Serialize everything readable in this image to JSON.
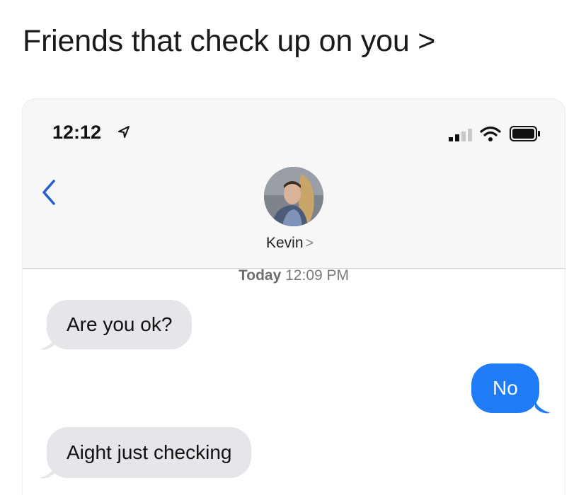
{
  "caption": "Friends that check up on you >",
  "status_bar": {
    "time": "12:12",
    "icons": [
      "location-arrow-icon",
      "signal-icon",
      "wifi-icon",
      "battery-icon"
    ]
  },
  "header": {
    "back_icon": "chevron-left-icon",
    "contact_name": "Kevin",
    "contact_chevron": ">"
  },
  "thread": {
    "timestamp_day": "Today",
    "timestamp_time": "12:09 PM",
    "messages": [
      {
        "from": "them",
        "text": "Are you ok?"
      },
      {
        "from": "me",
        "text": "No"
      },
      {
        "from": "them",
        "text": "Aight just checking"
      }
    ]
  },
  "colors": {
    "sent_bubble": "#1f7cf6",
    "received_bubble": "#e5e5ea",
    "back_chevron": "#1f5fcf"
  }
}
